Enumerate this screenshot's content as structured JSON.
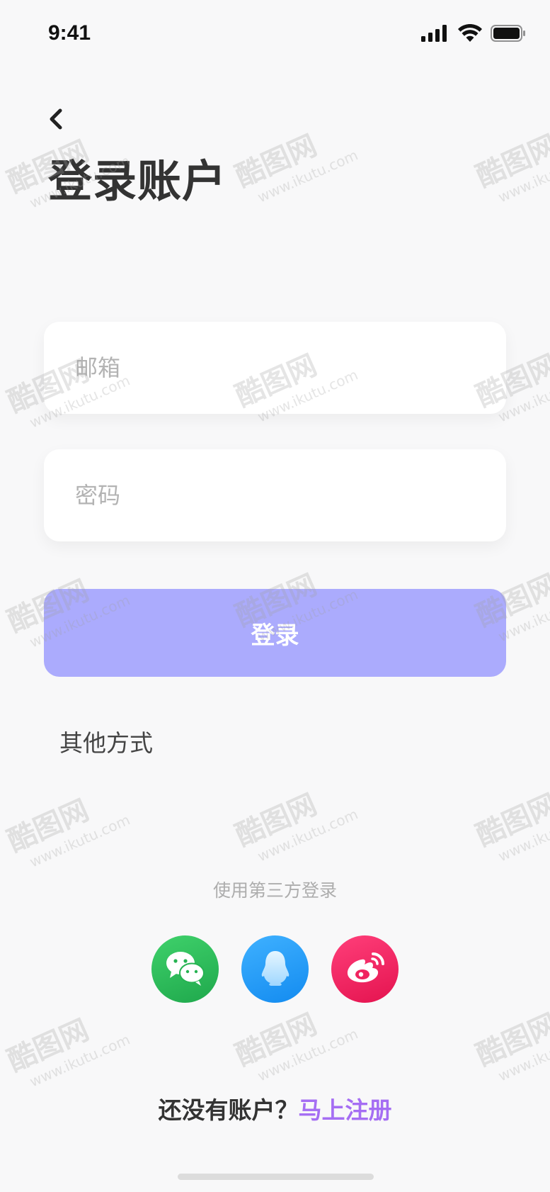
{
  "status_bar": {
    "time": "9:41"
  },
  "header": {
    "title": "登录账户"
  },
  "form": {
    "email_placeholder": "邮箱",
    "password_placeholder": "密码",
    "email_value": "",
    "password_value": "",
    "login_label": "登录"
  },
  "other": {
    "label": "其他方式"
  },
  "third_party": {
    "label": "使用第三方登录",
    "providers": [
      {
        "name": "wechat",
        "icon": "wechat-icon",
        "color": "#2fc05c"
      },
      {
        "name": "qq",
        "icon": "qq-penguin-icon",
        "color": "#229ef8"
      },
      {
        "name": "weibo",
        "icon": "weibo-icon",
        "color": "#f0245f"
      }
    ]
  },
  "register": {
    "prompt": "还没有账户？",
    "link": "马上注册"
  },
  "watermark": {
    "main": "酷图网",
    "url": "www.ikutu.com"
  },
  "colors": {
    "primary_button": "#ababfd",
    "link": "#a56ef3",
    "background": "#f8f8f9"
  }
}
